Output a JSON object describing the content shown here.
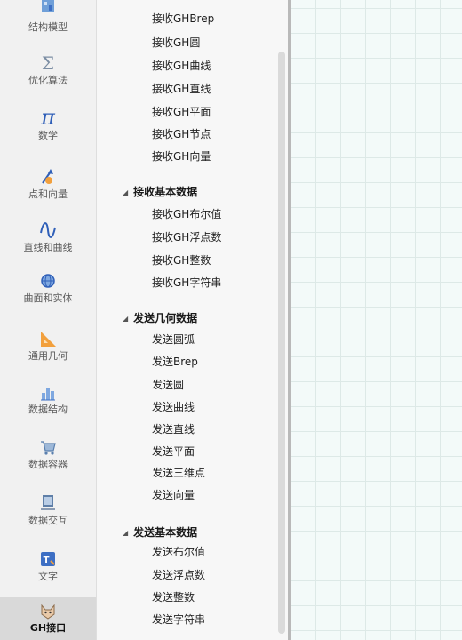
{
  "rail": {
    "items": [
      {
        "label": "结构模型",
        "icon": "structure-model-icon"
      },
      {
        "label": "优化算法",
        "icon": "sigma-icon"
      },
      {
        "label": "数学",
        "icon": "pi-icon"
      },
      {
        "label": "点和向量",
        "icon": "point-vector-icon"
      },
      {
        "label": "直线和曲线",
        "icon": "curve-icon"
      },
      {
        "label": "曲面和实体",
        "icon": "surface-solid-icon"
      },
      {
        "label": "通用几何",
        "icon": "ruler-triangle-icon"
      },
      {
        "label": "数据结构",
        "icon": "data-structure-icon"
      },
      {
        "label": "数据容器",
        "icon": "cart-icon"
      },
      {
        "label": "数据交互",
        "icon": "computer-icon"
      },
      {
        "label": "文字",
        "icon": "text-icon"
      },
      {
        "label": "GH接口",
        "icon": "gh-cat-icon",
        "active": true
      }
    ]
  },
  "list": {
    "receive_geometry_items": [
      "接收GHBrep",
      "接收GH圆",
      "接收GH曲线",
      "接收GH直线",
      "接收GH平面",
      "接收GH节点",
      "接收GH向量"
    ],
    "receive_basic_header": "接收基本数据",
    "receive_basic_items": [
      "接收GH布尔值",
      "接收GH浮点数",
      "接收GH整数",
      "接收GH字符串"
    ],
    "send_geometry_header": "发送几何数据",
    "send_geometry_items": [
      "发送圆弧",
      "发送Brep",
      "发送圆",
      "发送曲线",
      "发送直线",
      "发送平面",
      "发送三维点",
      "发送向量"
    ],
    "send_basic_header": "发送基本数据",
    "send_basic_items": [
      "发送布尔值",
      "发送浮点数",
      "发送整数",
      "发送字符串"
    ]
  },
  "colors": {
    "accent_orange": "#f2a03d",
    "accent_blue": "#3d6fc4",
    "canvas_bg": "#f3faf9",
    "grid_line": "#dde9e7"
  }
}
